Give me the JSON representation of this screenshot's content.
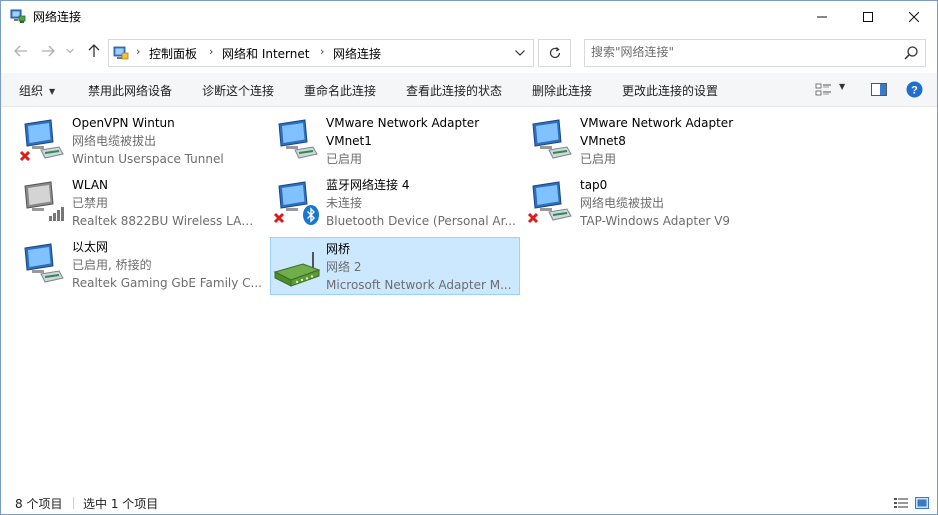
{
  "window": {
    "title": "网络连接"
  },
  "nav": {
    "breadcrumbs": [
      "控制面板",
      "网络和 Internet",
      "网络连接"
    ],
    "search_placeholder": "搜索\"网络连接\""
  },
  "toolbar": {
    "organize": "组织",
    "disable": "禁用此网络设备",
    "diagnose": "诊断这个连接",
    "rename": "重命名此连接",
    "status": "查看此连接的状态",
    "delete": "删除此连接",
    "settings": "更改此连接的设置"
  },
  "items": [
    {
      "name": "OpenVPN Wintun",
      "status": "网络电缆被拔出",
      "device": "Wintun Userspace Tunnel",
      "icon": "network-adapter-disconnected-icon",
      "selected": false
    },
    {
      "name": "VMware Network Adapter VMnet1",
      "status": "已启用",
      "device": "",
      "icon": "network-adapter-icon",
      "selected": false
    },
    {
      "name": "VMware Network Adapter VMnet8",
      "status": "已启用",
      "device": "",
      "icon": "network-adapter-icon",
      "selected": false
    },
    {
      "name": "WLAN",
      "status": "已禁用",
      "device": "Realtek 8822BU Wireless LAN ...",
      "icon": "wifi-adapter-disabled-icon",
      "selected": false
    },
    {
      "name": "蓝牙网络连接 4",
      "status": "未连接",
      "device": "Bluetooth Device (Personal Ar...",
      "icon": "bluetooth-adapter-icon",
      "selected": false
    },
    {
      "name": "tap0",
      "status": "网络电缆被拔出",
      "device": "TAP-Windows Adapter V9",
      "icon": "network-adapter-disconnected-icon",
      "selected": false
    },
    {
      "name": "以太网",
      "status": "已启用, 桥接的",
      "device": "Realtek Gaming GbE Family C...",
      "icon": "ethernet-adapter-icon",
      "selected": false
    },
    {
      "name": "网桥",
      "status": "网络 2",
      "device": "Microsoft Network Adapter M...",
      "icon": "network-bridge-icon",
      "selected": true
    }
  ],
  "statusbar": {
    "count": "8 个项目",
    "selected": "选中 1 个项目"
  },
  "colors": {
    "selection_bg": "#cce8ff",
    "selection_border": "#99d1ff",
    "secondary_text": "#6d6d6d",
    "help_blue": "#1e6fd0"
  }
}
